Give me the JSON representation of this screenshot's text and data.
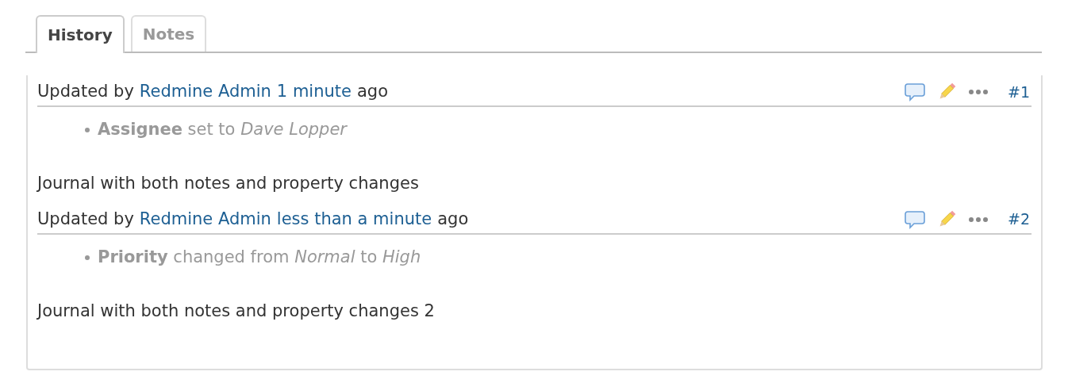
{
  "tabs": [
    {
      "label": "History",
      "selected": true
    },
    {
      "label": "Notes",
      "selected": false
    }
  ],
  "journals": [
    {
      "prefix": "Updated by",
      "author": "Redmine Admin",
      "age": "1 minute",
      "suffix": "ago",
      "number": "#1",
      "details": [
        "**Assignee** set to *Dave Lopper*"
      ],
      "notes": "Journal with both notes and property changes"
    },
    {
      "prefix": "Updated by",
      "author": "Redmine Admin",
      "age": "less than a minute",
      "suffix": "ago",
      "number": "#2",
      "details": [
        "**Priority** changed from *Normal* to *High*"
      ],
      "notes": "Journal with both notes and property changes 2"
    }
  ]
}
